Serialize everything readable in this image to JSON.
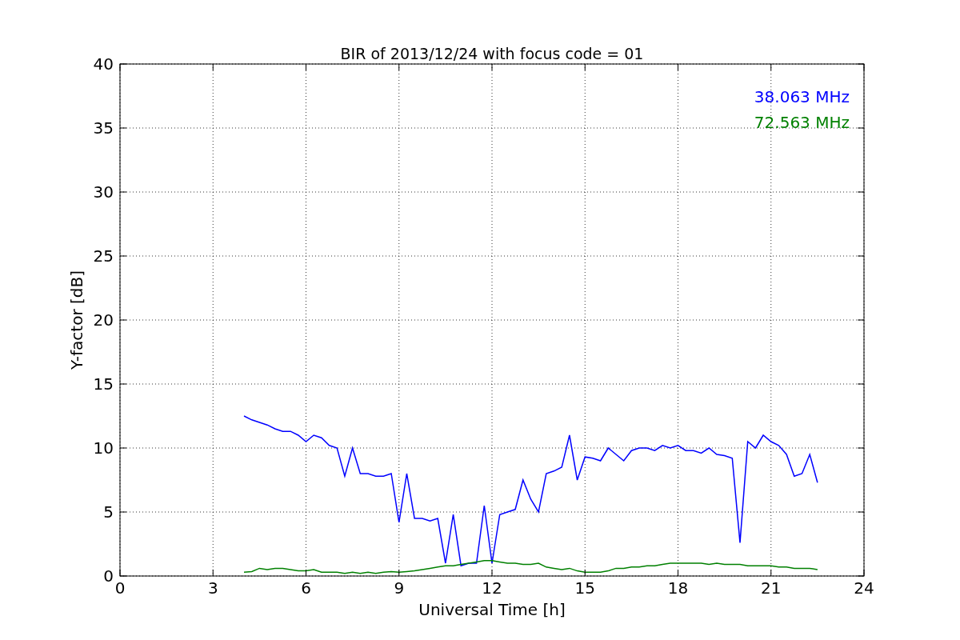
{
  "figure": {
    "chart_data": {
      "type": "line",
      "title": "BIR of 2013/12/24 with focus code = 01",
      "xlabel": "Universal Time [h]",
      "ylabel": "Y-factor [dB]",
      "x": [
        4,
        4.25,
        4.5,
        4.75,
        5,
        5.25,
        5.5,
        5.75,
        6,
        6.25,
        6.5,
        6.75,
        7,
        7.25,
        7.5,
        7.75,
        8,
        8.25,
        8.5,
        8.75,
        9,
        9.25,
        9.5,
        9.75,
        10,
        10.25,
        10.5,
        10.75,
        11,
        11.25,
        11.5,
        11.75,
        12,
        12.25,
        12.5,
        12.75,
        13,
        13.25,
        13.5,
        13.75,
        14,
        14.25,
        14.5,
        14.75,
        15,
        15.25,
        15.5,
        15.75,
        16,
        16.25,
        16.5,
        16.75,
        17,
        17.25,
        17.5,
        17.75,
        18,
        18.25,
        18.5,
        18.75,
        19,
        19.25,
        19.5,
        19.75,
        20,
        20.25,
        20.5,
        20.75,
        21,
        21.25,
        21.5,
        21.75,
        22,
        22.25,
        22.5
      ],
      "series": [
        {
          "name": "38.063 MHz",
          "color": "#0000ff",
          "values": [
            12.5,
            12.2,
            12.0,
            11.8,
            11.5,
            11.3,
            11.3,
            11.0,
            10.5,
            11.0,
            10.8,
            10.2,
            10.0,
            7.8,
            10.0,
            8.0,
            8.0,
            7.8,
            7.8,
            8.0,
            4.2,
            8.0,
            4.5,
            4.5,
            4.3,
            4.5,
            1.0,
            4.8,
            0.8,
            1.0,
            1.0,
            5.5,
            1.0,
            4.8,
            5.0,
            5.2,
            7.5,
            6.0,
            5.0,
            8.0,
            8.2,
            8.5,
            11.0,
            7.5,
            9.3,
            9.2,
            9.0,
            10.0,
            9.5,
            9.0,
            9.8,
            10.0,
            10.0,
            9.8,
            10.2,
            10.0,
            10.2,
            9.8,
            9.8,
            9.6,
            10.0,
            9.5,
            9.4,
            9.2,
            2.6,
            10.5,
            10.0,
            11.0,
            10.5,
            10.2,
            9.5,
            7.8,
            8.0,
            9.5,
            7.3
          ]
        },
        {
          "name": "72.563 MHz",
          "color": "#008000",
          "values": [
            0.3,
            0.35,
            0.6,
            0.5,
            0.6,
            0.6,
            0.5,
            0.4,
            0.4,
            0.5,
            0.3,
            0.3,
            0.3,
            0.2,
            0.3,
            0.2,
            0.3,
            0.2,
            0.3,
            0.35,
            0.3,
            0.35,
            0.4,
            0.5,
            0.6,
            0.7,
            0.8,
            0.8,
            0.9,
            1.0,
            1.1,
            1.2,
            1.2,
            1.1,
            1.0,
            1.0,
            0.9,
            0.9,
            1.0,
            0.7,
            0.6,
            0.5,
            0.6,
            0.4,
            0.3,
            0.3,
            0.3,
            0.4,
            0.6,
            0.6,
            0.7,
            0.7,
            0.8,
            0.8,
            0.9,
            1.0,
            1.0,
            1.0,
            1.0,
            1.0,
            0.9,
            1.0,
            0.9,
            0.9,
            0.9,
            0.8,
            0.8,
            0.8,
            0.8,
            0.7,
            0.7,
            0.6,
            0.6,
            0.6,
            0.5
          ]
        }
      ],
      "xlim": [
        0,
        24
      ],
      "ylim": [
        0,
        40
      ],
      "xticks": [
        0,
        3,
        6,
        9,
        12,
        15,
        18,
        21,
        24
      ],
      "yticks": [
        0,
        5,
        10,
        15,
        20,
        25,
        30,
        35,
        40
      ],
      "grid": true
    }
  }
}
